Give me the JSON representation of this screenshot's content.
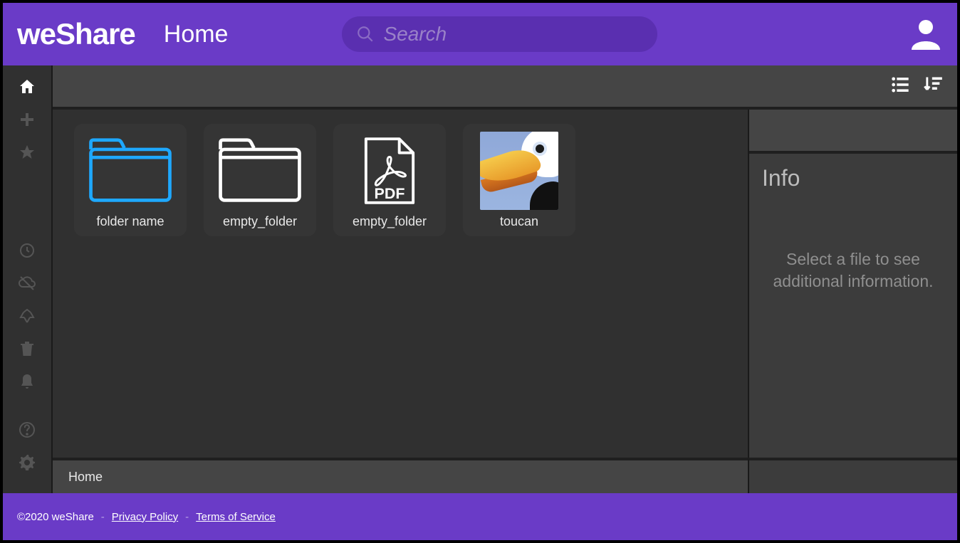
{
  "app_name": "weShare",
  "header": {
    "page_title": "Home",
    "search_placeholder": "Search"
  },
  "toolbar": {
    "view_mode": "list",
    "sort_mode": "descending"
  },
  "files": [
    {
      "type": "folder",
      "label": "folder name",
      "selected": true
    },
    {
      "type": "folder",
      "label": "empty_folder",
      "selected": false
    },
    {
      "type": "pdf",
      "label": "empty_folder",
      "selected": false
    },
    {
      "type": "image",
      "label": "toucan",
      "selected": false
    }
  ],
  "info_panel": {
    "title": "Info",
    "empty_message": "Select a file to see additional information."
  },
  "breadcrumb": "Home",
  "footer": {
    "copyright": "©2020 weShare",
    "privacy": "Privacy Policy",
    "terms": "Terms of Service"
  }
}
